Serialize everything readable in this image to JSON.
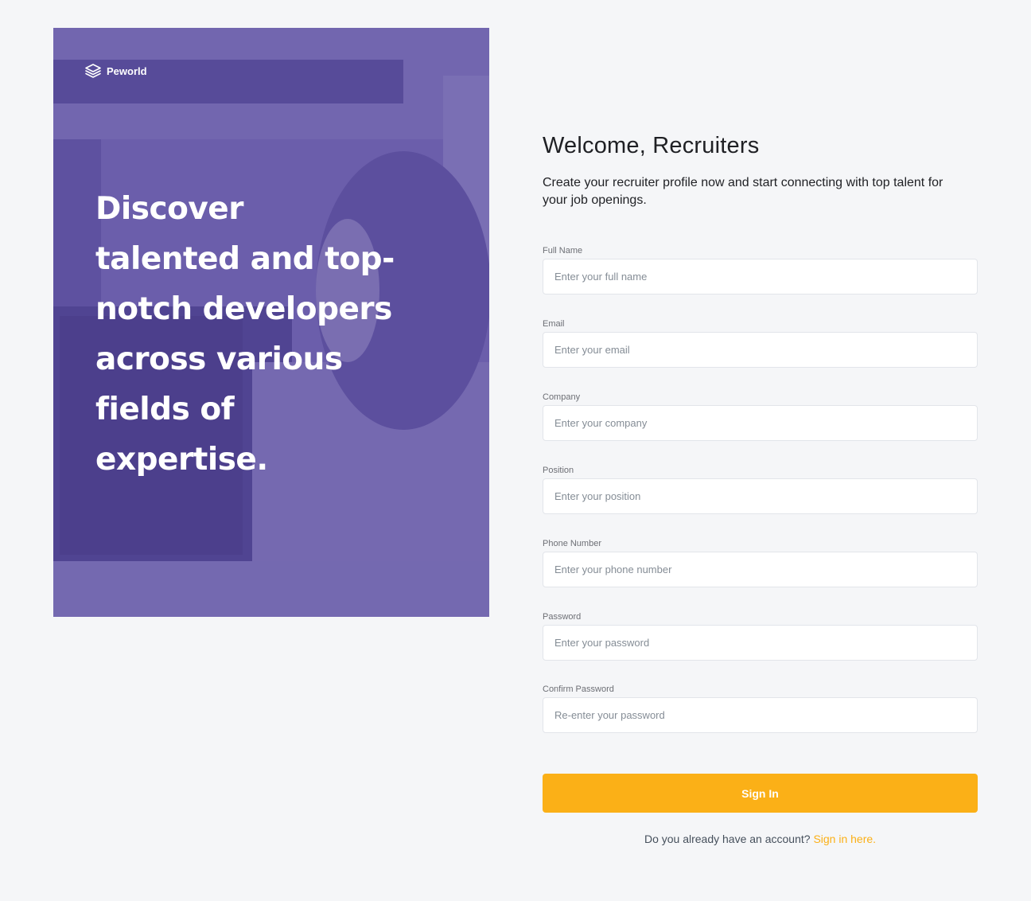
{
  "hero": {
    "brand_name": "Peworld",
    "brand_icon": "layers-icon",
    "heading": "Discover talented and top-notch developers across various fields of expertise."
  },
  "form": {
    "title": "Welcome, Recruiters",
    "subtitle": "Create your recruiter profile now and start connecting with top talent for your job openings.",
    "fields": [
      {
        "label": "Full Name",
        "placeholder": "Enter your full name"
      },
      {
        "label": "Email",
        "placeholder": "Enter your email"
      },
      {
        "label": "Company",
        "placeholder": "Enter your company"
      },
      {
        "label": "Position",
        "placeholder": "Enter your position"
      },
      {
        "label": "Phone Number",
        "placeholder": "Enter your phone number"
      },
      {
        "label": "Password",
        "placeholder": "Enter your password"
      },
      {
        "label": "Confirm Password",
        "placeholder": "Re-enter your password"
      }
    ],
    "submit_label": "Sign In",
    "footer_text": "Do you already have an account?",
    "footer_link": "Sign in here."
  },
  "colors": {
    "accent": "#fbb017",
    "hero_overlay": "#5e50a1",
    "background": "#f5f6f8"
  }
}
